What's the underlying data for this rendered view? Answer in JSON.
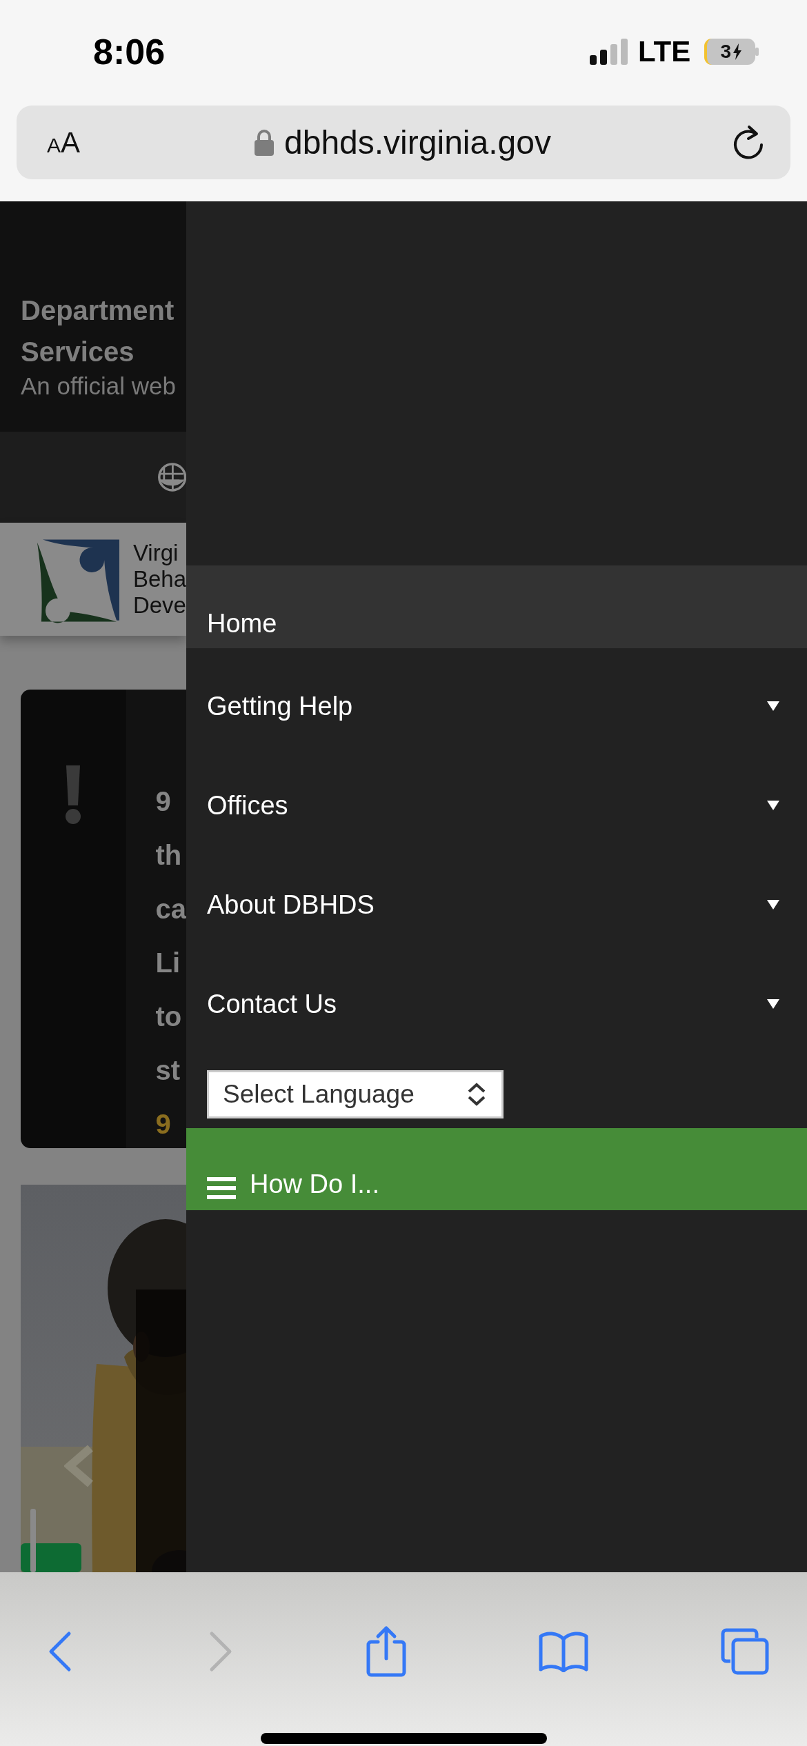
{
  "status_bar": {
    "time": "8:06",
    "network": "LTE",
    "battery": "3"
  },
  "address_bar": {
    "text_size_button": "AA",
    "url": "dbhds.virginia.gov"
  },
  "page": {
    "header": {
      "title_lines": [
        "Department",
        "Services"
      ],
      "subtitle": "An official web"
    },
    "logo_text": [
      "Virgi",
      "Beha",
      "Deve"
    ],
    "alert": {
      "lines": [
        {
          "text": "9",
          "highlight": false
        },
        {
          "text": "th",
          "highlight": false
        },
        {
          "text": "ca",
          "highlight": false
        },
        {
          "text": "Li",
          "highlight": false
        },
        {
          "text": "to",
          "highlight": false
        },
        {
          "text": "st",
          "highlight": false
        },
        {
          "text": "9",
          "highlight": true
        }
      ]
    }
  },
  "menu": {
    "items": [
      {
        "label": "Home",
        "selected": true,
        "has_submenu": false
      },
      {
        "label": "Getting Help",
        "selected": false,
        "has_submenu": true
      },
      {
        "label": "Offices",
        "selected": false,
        "has_submenu": true
      },
      {
        "label": "About DBHDS",
        "selected": false,
        "has_submenu": true
      },
      {
        "label": "Contact Us",
        "selected": false,
        "has_submenu": true
      }
    ],
    "language_select": {
      "value": "Select Language"
    },
    "how_do_i": {
      "label": "How Do I..."
    }
  },
  "toolbar": {
    "back_enabled": true,
    "forward_enabled": false
  }
}
